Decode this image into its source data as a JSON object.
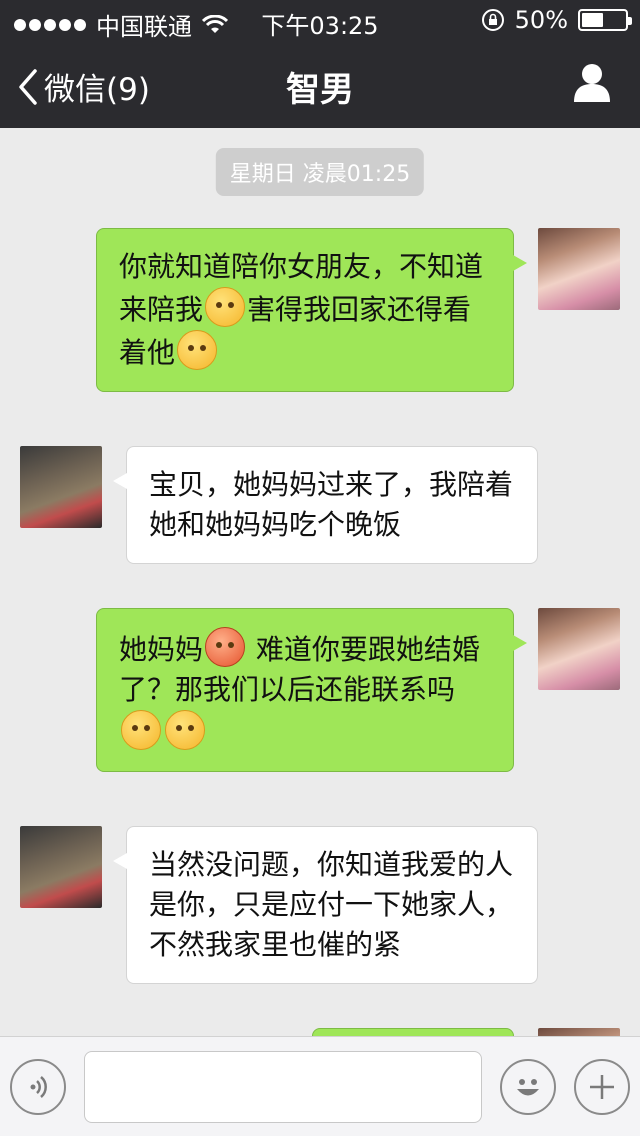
{
  "status_bar": {
    "carrier": "中国联通",
    "time": "下午03:25",
    "battery_text": "50%",
    "battery_level": 0.5
  },
  "nav": {
    "back_label": "微信(9)",
    "title": "智男"
  },
  "chat": {
    "timestamp": "星期日 凌晨01:25",
    "messages": [
      {
        "sender": "me",
        "lines": [
          "你就知道陪你女朋友，不知道",
          "来陪我",
          "害得我回家还得看",
          "着他"
        ]
      },
      {
        "sender": "them",
        "lines": [
          "宝贝，她妈妈过来了，我陪着",
          "她和她妈妈吃个晚饭"
        ]
      },
      {
        "sender": "me",
        "lines": [
          "她妈妈",
          " 难道你要跟她结婚",
          "了？那我们以后还能联系吗"
        ]
      },
      {
        "sender": "them",
        "lines": [
          "当然没问题，你知道我爱的人",
          "是你，只是应付一下她家人，",
          "不然我家里也催的紧"
        ]
      }
    ]
  },
  "colors": {
    "topbar": "#2b2b2f",
    "my_bubble": "#9fe658",
    "their_bubble": "#ffffff",
    "background": "#ebebeb"
  }
}
